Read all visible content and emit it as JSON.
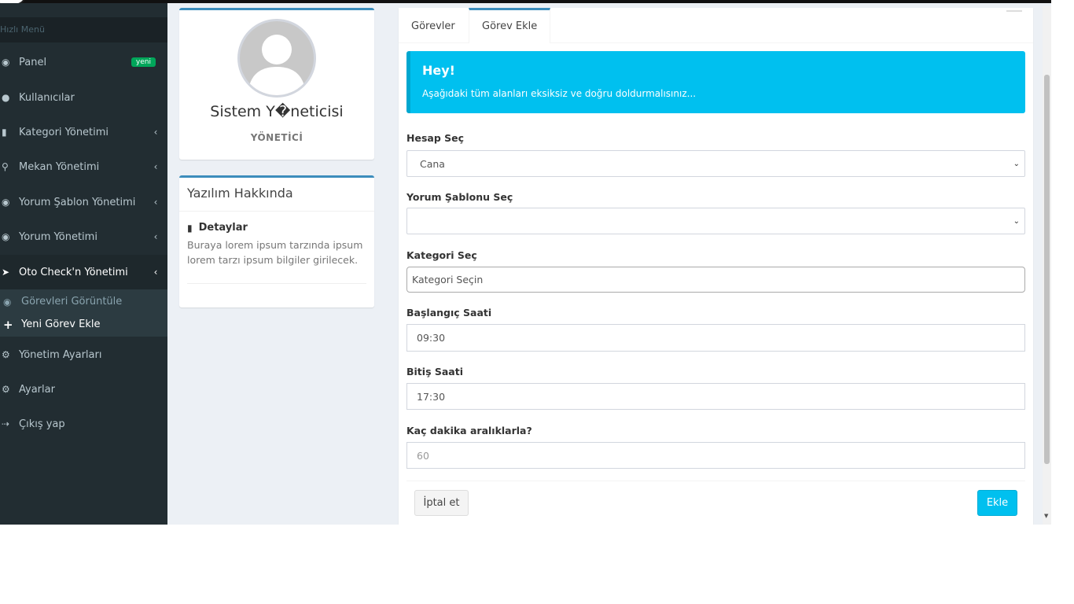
{
  "sidebar": {
    "header": "Hızlı Menü",
    "items": [
      {
        "label": "Panel",
        "icon": "dashboard-icon",
        "badge": "yeni"
      },
      {
        "label": "Kullanıcılar",
        "icon": "users-icon"
      },
      {
        "label": "Kategori Yönetimi",
        "icon": "book-icon"
      },
      {
        "label": "Mekan Yönetimi",
        "icon": "map-marker-icon"
      },
      {
        "label": "Yorum Şablon Yönetimi",
        "icon": "comments-icon"
      },
      {
        "label": "Yorum Yönetimi",
        "icon": "comments-icon"
      },
      {
        "label": "Oto Check'n Yönetimi",
        "icon": "location-arrow-icon"
      },
      {
        "label": "Yönetim Ayarları",
        "icon": "gear-icon"
      },
      {
        "label": "Ayarlar",
        "icon": "gear-icon"
      },
      {
        "label": "Çıkış yap",
        "icon": "sign-out-icon"
      }
    ],
    "subitems": [
      {
        "label": "Görevleri Görüntüle",
        "icon": "eye-icon"
      },
      {
        "label": "Yeni Görev Ekle",
        "icon": "plus-icon"
      }
    ]
  },
  "profile": {
    "name": "Sistem Y�neticisi",
    "role": "YÖNETİCİ"
  },
  "about": {
    "title": "Yazılım Hakkında",
    "subtitle": "Detaylar",
    "text": "Buraya lorem ipsum tarzında ipsum lorem tarzı ipsum bilgiler girilecek."
  },
  "tabs": [
    {
      "label": "Görevler"
    },
    {
      "label": "Görev Ekle"
    }
  ],
  "callout": {
    "title": "Hey!",
    "text": "Aşağıdaki tüm alanları eksiksiz ve doğru doldurmalısınız..."
  },
  "form": {
    "account": {
      "label": "Hesap Seç",
      "value": "Cana"
    },
    "template": {
      "label": "Yorum Şablonu Seç",
      "value": ""
    },
    "category": {
      "label": "Kategori Seç",
      "placeholder": "Kategori Seçin"
    },
    "start": {
      "label": "Başlangıç Saati",
      "value": "09:30"
    },
    "end": {
      "label": "Bitiş Saati",
      "value": "17:30"
    },
    "interval": {
      "label": "Kaç dakika aralıklarla?",
      "placeholder": "60"
    }
  },
  "buttons": {
    "cancel": "İptal et",
    "add": "Ekle"
  },
  "colors": {
    "sidebar": "#222d32",
    "accent": "#3c8dbc",
    "info": "#00c0ef",
    "badge": "#00a65a"
  }
}
